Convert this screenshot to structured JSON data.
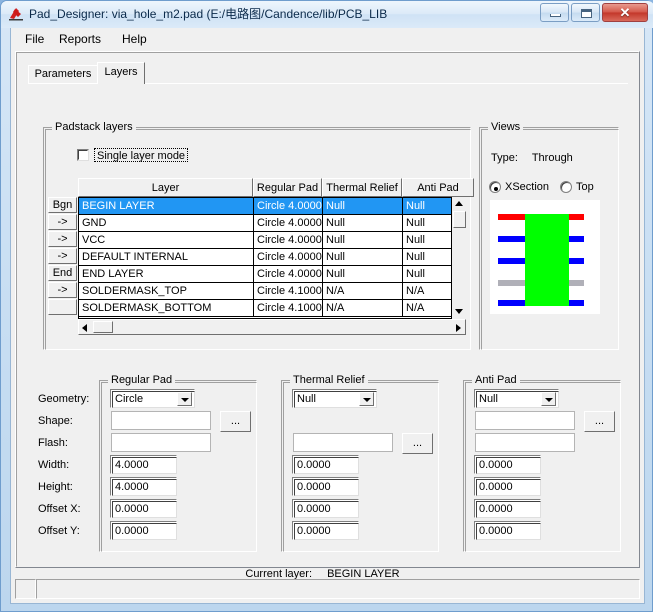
{
  "window": {
    "title": "Pad_Designer: via_hole_m2.pad (E:/电路图/Candence/lib/PCB_LIB",
    "icon": "pad-designer-icon",
    "minimize_label": "Minimize",
    "maximize_label": "Maximize",
    "close_label": "✕"
  },
  "menubar": {
    "items": [
      {
        "label": "File"
      },
      {
        "label": "Reports"
      },
      {
        "label": "Help"
      }
    ]
  },
  "tabs": [
    {
      "label": "Parameters",
      "active": false
    },
    {
      "label": "Layers",
      "active": true
    }
  ],
  "padstack": {
    "group_title": "Padstack layers",
    "single_layer_mode": {
      "label": "Single layer mode",
      "checked": false
    },
    "columns": [
      "Layer",
      "Regular Pad",
      "Thermal Relief",
      "Anti Pad"
    ],
    "rows": [
      {
        "handle": "Bgn",
        "layer": "BEGIN LAYER",
        "regular_pad": "Circle 4.0000",
        "thermal_relief": "Null",
        "anti_pad": "Null",
        "selected": true
      },
      {
        "handle": "->",
        "layer": "GND",
        "regular_pad": "Circle 4.0000",
        "thermal_relief": "Null",
        "anti_pad": "Null",
        "selected": false
      },
      {
        "handle": "->",
        "layer": "VCC",
        "regular_pad": "Circle 4.0000",
        "thermal_relief": "Null",
        "anti_pad": "Null",
        "selected": false
      },
      {
        "handle": "->",
        "layer": "DEFAULT INTERNAL",
        "regular_pad": "Circle 4.0000",
        "thermal_relief": "Null",
        "anti_pad": "Null",
        "selected": false
      },
      {
        "handle": "End",
        "layer": "END LAYER",
        "regular_pad": "Circle 4.0000",
        "thermal_relief": "Null",
        "anti_pad": "Null",
        "selected": false
      },
      {
        "handle": "->",
        "layer": "SOLDERMASK_TOP",
        "regular_pad": "Circle 4.1000",
        "thermal_relief": "N/A",
        "anti_pad": "N/A",
        "selected": false
      },
      {
        "handle": "",
        "layer": "SOLDERMASK_BOTTOM",
        "regular_pad": "Circle 4.1000",
        "thermal_relief": "N/A",
        "anti_pad": "N/A",
        "selected": false
      }
    ]
  },
  "views": {
    "group_title": "Views",
    "type_label": "Type:",
    "type_value": "Through",
    "radios": [
      {
        "label": "XSection",
        "selected": true
      },
      {
        "label": "Top",
        "selected": false
      }
    ],
    "preview": {
      "background": "#ffffff",
      "barrel_color": "#00ff00",
      "layer_bars": [
        {
          "color": "#ff0000"
        },
        {
          "color": "#0000ff"
        },
        {
          "color": "#0000ff"
        },
        {
          "color": "#b0b0b8"
        },
        {
          "color": "#0000ff"
        }
      ]
    }
  },
  "field_labels": [
    "Geometry:",
    "Shape:",
    "Flash:",
    "Width:",
    "Height:",
    "Offset X:",
    "Offset Y:"
  ],
  "browse_button_label": "...",
  "regular_pad": {
    "group_title": "Regular Pad",
    "geometry": "Circle",
    "shape": "",
    "flash": "",
    "width": "4.0000",
    "height": "4.0000",
    "offset_x": "0.0000",
    "offset_y": "0.0000"
  },
  "thermal_relief": {
    "group_title": "Thermal Relief",
    "geometry": "Null",
    "flash": "",
    "width": "0.0000",
    "height": "0.0000",
    "offset_x": "0.0000",
    "offset_y": "0.0000"
  },
  "anti_pad": {
    "group_title": "Anti Pad",
    "geometry": "Null",
    "shape": "",
    "flash": "",
    "width": "0.0000",
    "height": "0.0000",
    "offset_x": "0.0000",
    "offset_y": "0.0000"
  },
  "current_layer": {
    "label": "Current layer:",
    "value": "BEGIN LAYER"
  },
  "statusbar": {
    "left_text": "",
    "right_text": ""
  }
}
